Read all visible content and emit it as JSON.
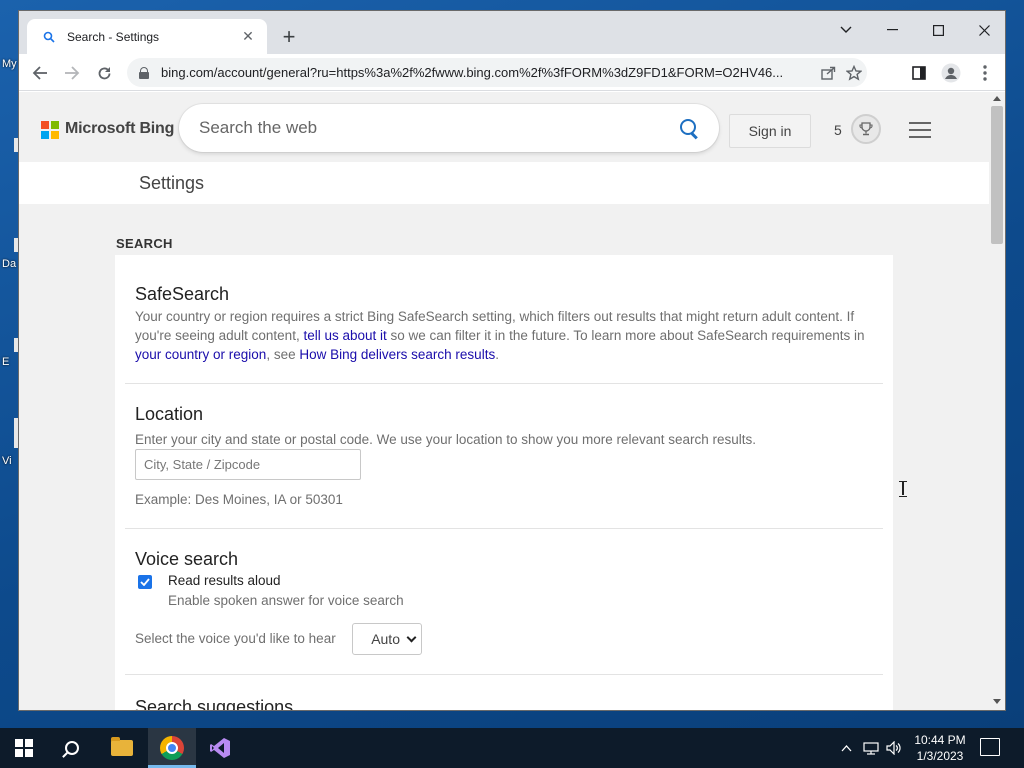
{
  "browser": {
    "tab_title": "Search - Settings",
    "tab_favicon": "search-icon",
    "tab_close": "✕",
    "new_tab": "+",
    "url": "bing.com/account/general?ru=https%3a%2f%2fwww.bing.com%2f%3fFORM%3dZ9FD1&FORM=O2HV46...",
    "window_controls": {
      "dropdown": "⌄",
      "minimize": "—",
      "maximize": "☐",
      "close": "✕"
    }
  },
  "bing": {
    "brand_bold": "Microsoft",
    "brand_rest": " Bing",
    "search_placeholder": "Search the web",
    "signin_label": "Sign in",
    "rewards_count": "5",
    "settings_title": "Settings"
  },
  "settings": {
    "section_label": "SEARCH",
    "safesearch": {
      "title": "SafeSearch",
      "text_1": "Your country or region requires a strict Bing SafeSearch setting, which filters out results that might return adult content. If you're seeing adult content, ",
      "link_1": "tell us about it",
      "text_2": " so we can filter it in the future. To learn more about SafeSearch requirements in ",
      "link_2": "your country or region",
      "text_3": ", see ",
      "link_3": "How Bing delivers search results",
      "text_4": "."
    },
    "location": {
      "title": "Location",
      "description": "Enter your city and state or postal code. We use your location to show you more relevant search results.",
      "placeholder": "City, State / Zipcode",
      "example": "Example: Des Moines, IA or 50301"
    },
    "voice": {
      "title": "Voice search",
      "checkbox_label": "Read results aloud",
      "checkbox_checked": true,
      "checkbox_sub": "Enable spoken answer for voice search",
      "voice_label": "Select the voice you'd like to hear",
      "voice_value": "Auto"
    },
    "next_section_title": "Search suggestions"
  },
  "taskbar": {
    "time": "10:44 PM",
    "date": "1/3/2023"
  },
  "desktop": {
    "labels": [
      "My",
      "Da",
      "E",
      "Vi"
    ]
  },
  "colors": {
    "ms_red": "#f25022",
    "ms_green": "#7fba00",
    "ms_blue": "#00a4ef",
    "ms_yellow": "#ffb900",
    "link": "#1a0dab",
    "checkbox": "#1a73e8"
  }
}
